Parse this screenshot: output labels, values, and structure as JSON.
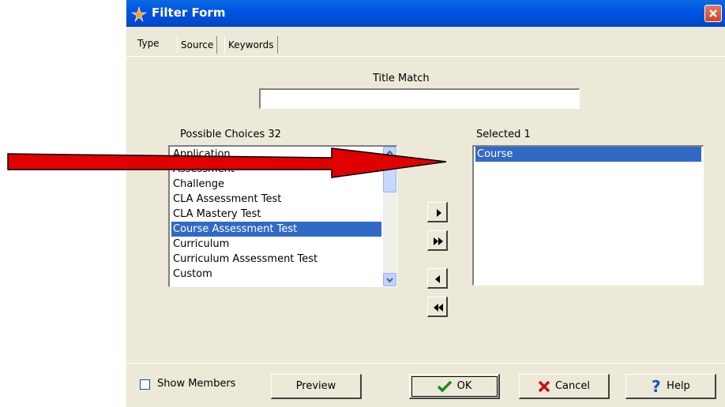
{
  "window": {
    "title": "Filter Form"
  },
  "tabs": [
    {
      "label": "Type",
      "active": true
    },
    {
      "label": "Source",
      "active": false
    },
    {
      "label": "Keywords",
      "active": false
    }
  ],
  "title_match": {
    "label": "Title Match",
    "value": ""
  },
  "possible": {
    "label": "Possible Choices 32",
    "items": [
      "Application",
      "Assessment",
      "Challenge",
      "CLA Assessment Test",
      "CLA Mastery Test",
      "Course Assessment Test",
      "Curriculum",
      "Curriculum Assessment Test",
      "Custom"
    ],
    "selected_index": 5
  },
  "selected": {
    "label": "Selected 1",
    "items": [
      "Course"
    ],
    "selected_index": 0
  },
  "footer": {
    "show_members": "Show Members",
    "preview": "Preview",
    "ok": "OK",
    "cancel": "Cancel",
    "help": "Help"
  },
  "colors": {
    "title_bar": "#0054e3",
    "selection": "#316ac5",
    "annotation_arrow": "#e00000"
  }
}
